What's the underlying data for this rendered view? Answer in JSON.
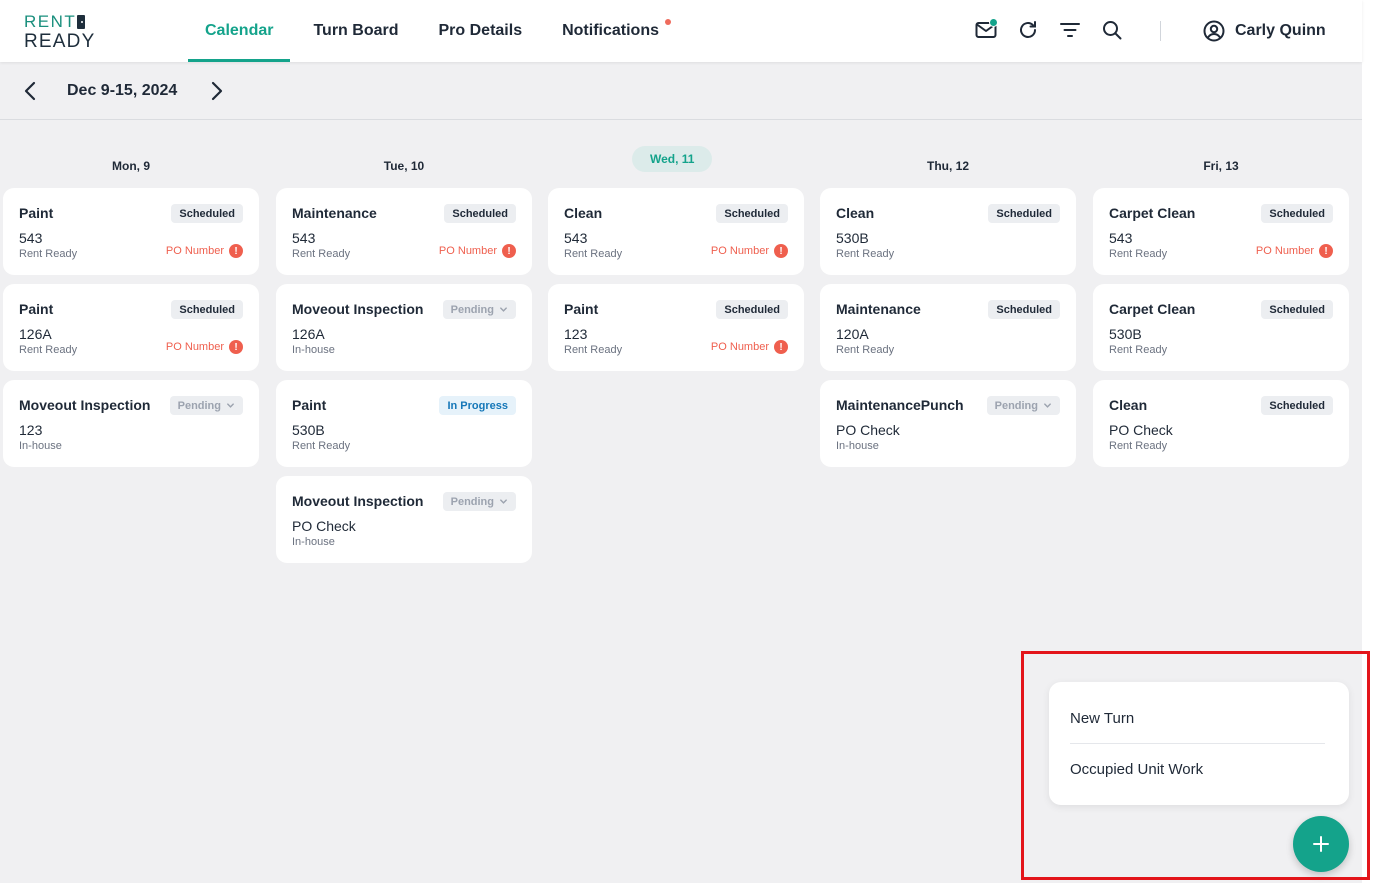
{
  "logo": {
    "line1": "RENT",
    "line2": "READY"
  },
  "nav": {
    "tabs": [
      {
        "label": "Calendar"
      },
      {
        "label": "Turn Board"
      },
      {
        "label": "Pro Details"
      },
      {
        "label": "Notifications"
      }
    ]
  },
  "header_icons": [
    "mail-icon",
    "refresh-icon",
    "filter-icon",
    "search-icon"
  ],
  "user": {
    "name": "Carly Quinn"
  },
  "date_range": "Dec 9-15, 2024",
  "days": [
    {
      "label": "Mon, 9",
      "cards": [
        {
          "title": "Paint",
          "unit": "543",
          "sub": "Rent Ready",
          "status": "Scheduled",
          "po": "PO Number"
        },
        {
          "title": "Paint",
          "unit": "126A",
          "sub": "Rent Ready",
          "status": "Scheduled",
          "po": "PO Number"
        },
        {
          "title": "Moveout Inspection",
          "unit": "123",
          "sub": "In-house",
          "status": "Pending",
          "po": ""
        }
      ]
    },
    {
      "label": "Tue, 10",
      "cards": [
        {
          "title": "Maintenance",
          "unit": "543",
          "sub": "Rent Ready",
          "status": "Scheduled",
          "po": "PO Number"
        },
        {
          "title": "Moveout Inspection",
          "unit": "126A",
          "sub": "In-house",
          "status": "Pending",
          "po": ""
        },
        {
          "title": "Paint",
          "unit": "530B",
          "sub": "Rent Ready",
          "status": "In Progress",
          "po": ""
        },
        {
          "title": "Moveout Inspection",
          "unit": "PO Check",
          "sub": "In-house",
          "status": "Pending",
          "po": ""
        }
      ]
    },
    {
      "label": "Wed, 11",
      "cards": [
        {
          "title": "Clean",
          "unit": "543",
          "sub": "Rent Ready",
          "status": "Scheduled",
          "po": "PO Number"
        },
        {
          "title": "Paint",
          "unit": "123",
          "sub": "Rent Ready",
          "status": "Scheduled",
          "po": "PO Number"
        }
      ]
    },
    {
      "label": "Thu, 12",
      "cards": [
        {
          "title": "Clean",
          "unit": "530B",
          "sub": "Rent Ready",
          "status": "Scheduled",
          "po": ""
        },
        {
          "title": "Maintenance",
          "unit": "120A",
          "sub": "Rent Ready",
          "status": "Scheduled",
          "po": ""
        },
        {
          "title": "MaintenancePunch",
          "unit": "PO Check",
          "sub": "In-house",
          "status": "Pending",
          "po": ""
        }
      ]
    },
    {
      "label": "Fri, 13",
      "cards": [
        {
          "title": "Carpet Clean",
          "unit": "543",
          "sub": "Rent Ready",
          "status": "Scheduled",
          "po": "PO Number"
        },
        {
          "title": "Carpet Clean",
          "unit": "530B",
          "sub": "Rent Ready",
          "status": "Scheduled",
          "po": ""
        },
        {
          "title": "Clean",
          "unit": "PO Check",
          "sub": "Rent Ready",
          "status": "Scheduled",
          "po": ""
        }
      ]
    }
  ],
  "add_menu": {
    "items": [
      {
        "label": "New Turn"
      },
      {
        "label": "Occupied Unit Work"
      }
    ]
  },
  "colors": {
    "accent": "#14a38b",
    "warning": "#ef5f4e",
    "highlight": "#e3151a"
  }
}
